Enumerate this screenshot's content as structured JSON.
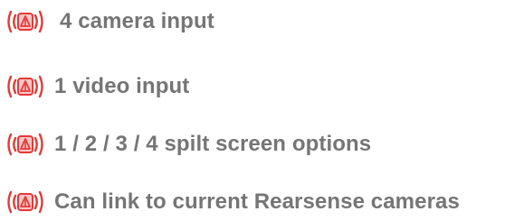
{
  "colors": {
    "bullet_red": "#e53935",
    "bullet_pink": "#f8c8c8",
    "text_gray": "#757575"
  },
  "features": {
    "items": [
      {
        "icon": "camera-signal-icon",
        "label": "4 camera input"
      },
      {
        "icon": "camera-signal-icon",
        "label": "1 video input"
      },
      {
        "icon": "camera-signal-icon",
        "label": "1 / 2 / 3 / 4 spilt screen options"
      },
      {
        "icon": "camera-signal-icon",
        "label": "Can link to current Rearsense cameras"
      }
    ]
  }
}
